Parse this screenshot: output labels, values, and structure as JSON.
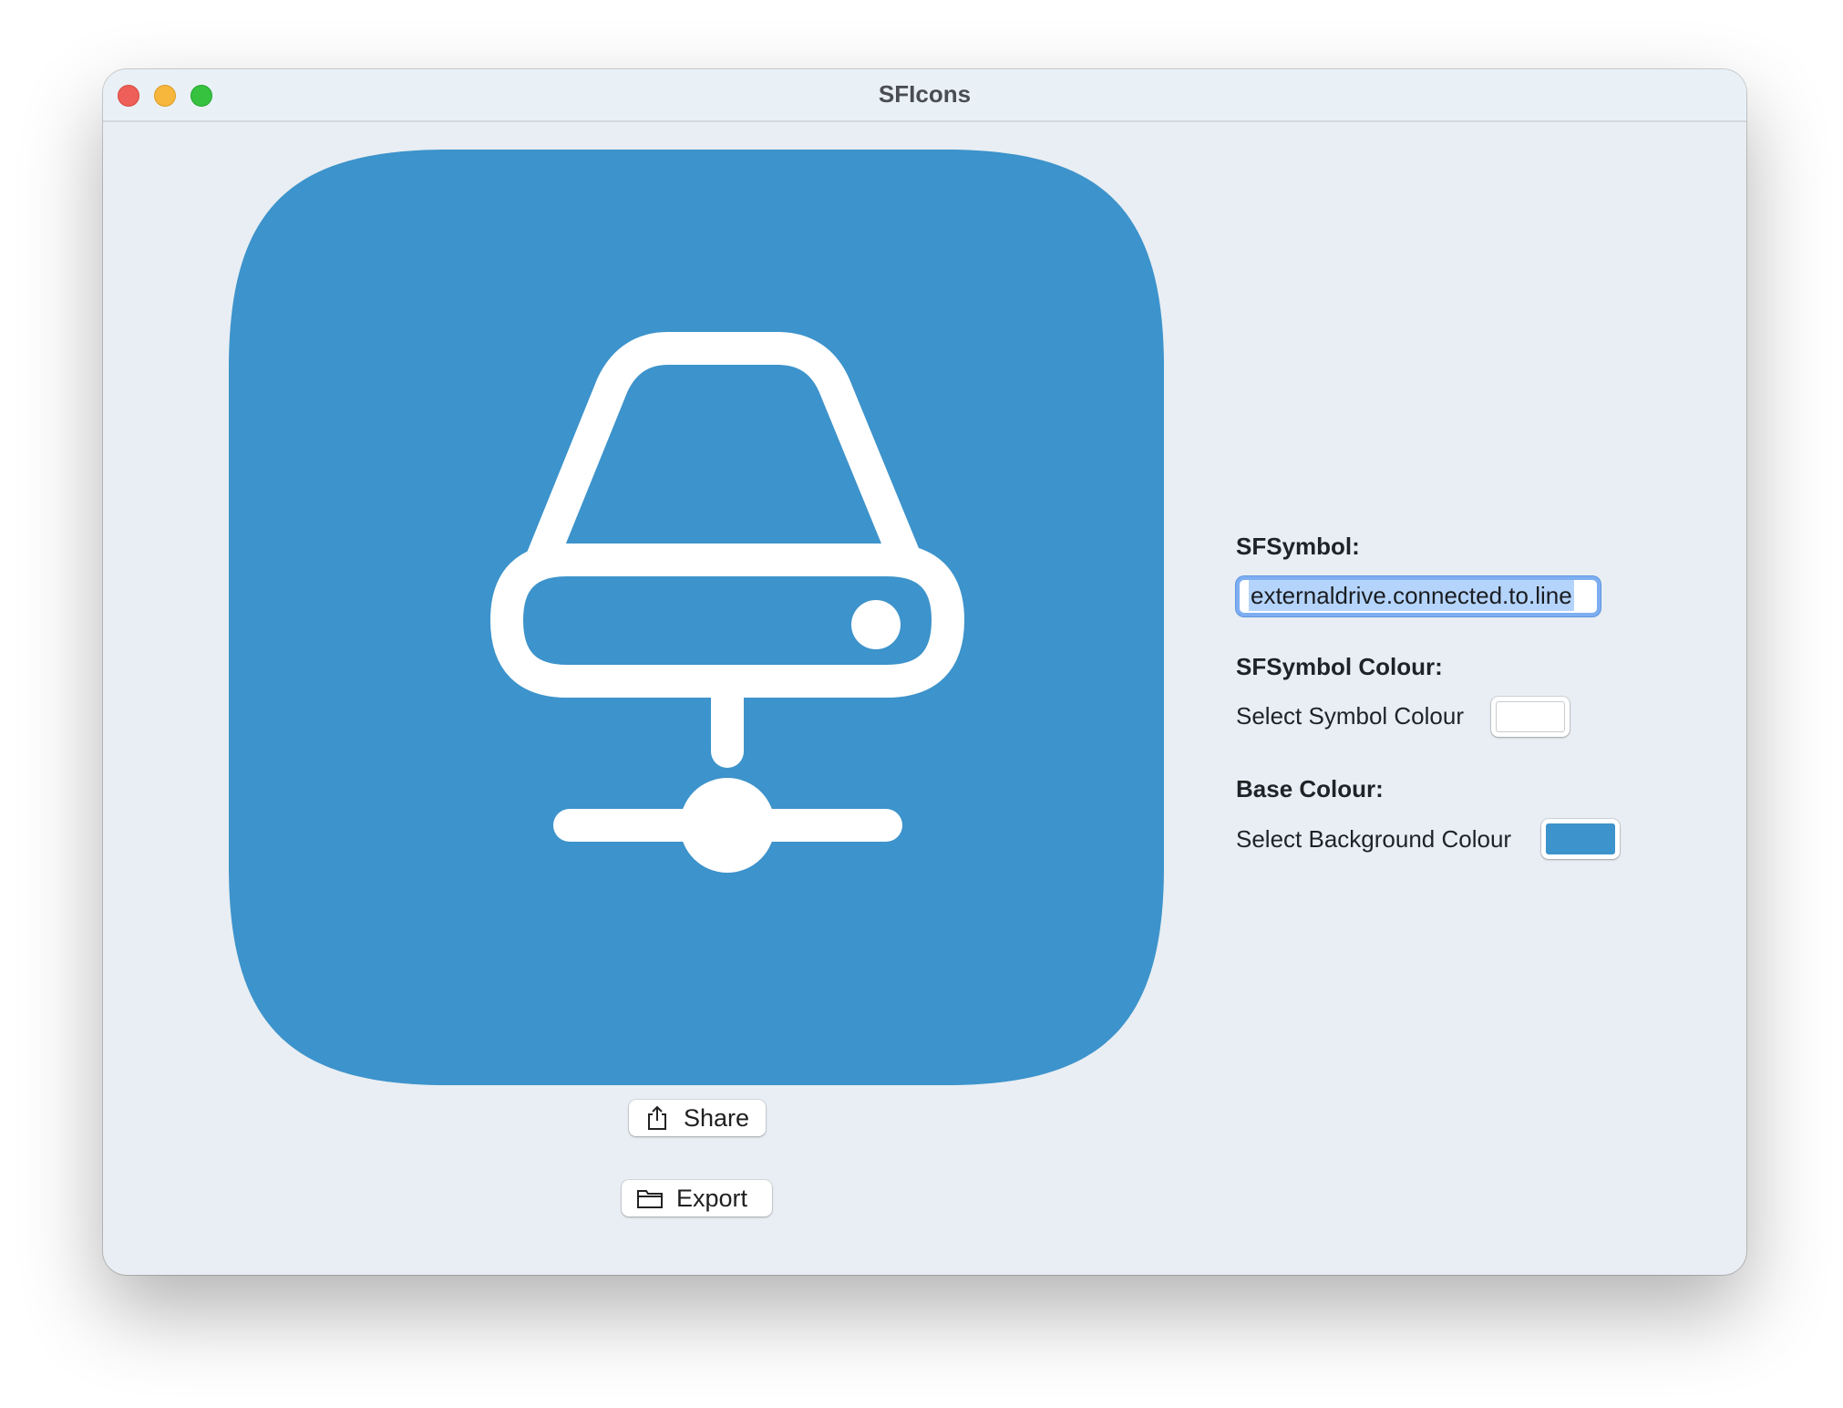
{
  "window": {
    "title": "SFIcons"
  },
  "preview": {
    "symbol_icon": "externaldrive-connected-to-line-icon",
    "base_color": "#3d93cb",
    "symbol_color": "#ffffff"
  },
  "actions": {
    "share_label": "Share",
    "share_icon": "share-icon",
    "export_label": "Export",
    "export_icon": "folder-icon"
  },
  "panel": {
    "symbol_heading": "SFSymbol:",
    "symbol_value": "externaldrive.connected.to.line",
    "symbol_colour_heading": "SFSymbol Colour:",
    "symbol_colour_label": "Select Symbol Colour",
    "symbol_colour_value": "#ffffff",
    "base_colour_heading": "Base Colour:",
    "base_colour_label": "Select Background Colour",
    "base_colour_value": "#3d93cb"
  }
}
